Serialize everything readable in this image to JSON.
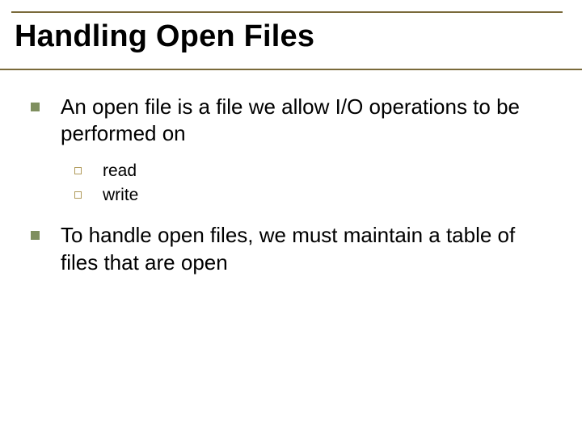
{
  "slide": {
    "title": "Handling Open Files",
    "bullets": [
      {
        "text": "An open file is a file we allow I/O operations to be performed on",
        "sub": [
          "read",
          "write"
        ]
      },
      {
        "text": "To handle open files, we must maintain a table of files that are open",
        "sub": []
      }
    ]
  }
}
